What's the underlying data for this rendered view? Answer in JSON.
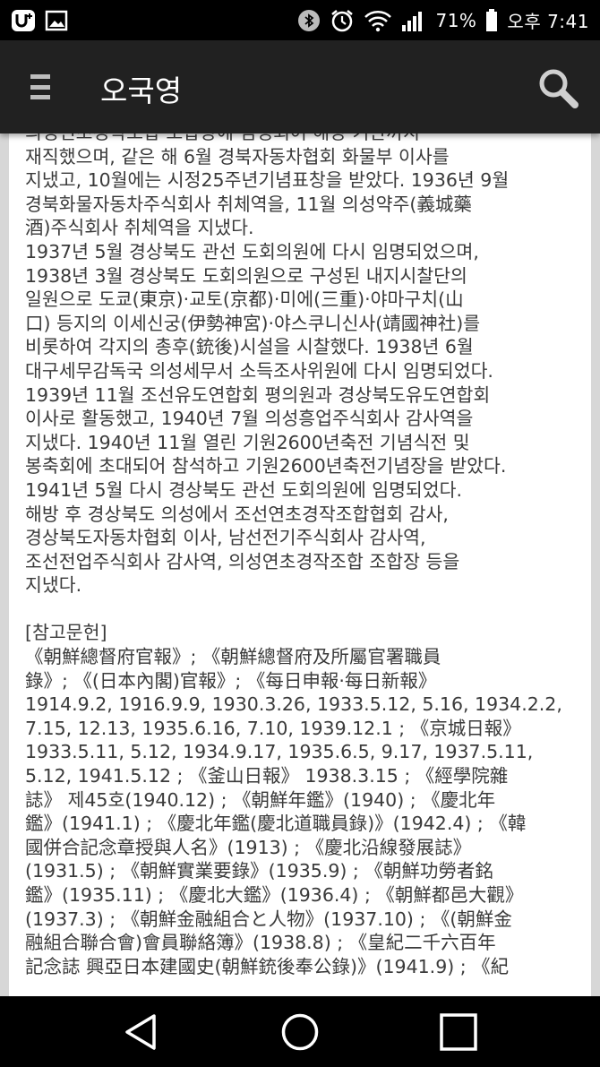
{
  "status_bar": {
    "battery_percent": "71%",
    "time": "오후 7:41",
    "icons": [
      "u-plus-icon",
      "image-icon",
      "bluetooth-icon",
      "alarm-icon",
      "wifi-icon",
      "signal-icon",
      "battery-icon"
    ]
  },
  "app_bar": {
    "title": "오국영",
    "menu_icon": "hamburger-menu-icon",
    "search_icon": "search-icon"
  },
  "article": {
    "lines": [
      "의성연초경작조합 조합장에 임명되어 해당 기관까지",
      "재직했으며, 같은 해 6월 경북자동차협회 화물부 이사를",
      "지냈고, 10월에는 시정25주년기념표창을 받았다. 1936년 9월",
      "경북화물자동차주식회사 취체역을, 11월 의성약주(義城藥",
      "酒)주식회사 취체역을 지냈다.",
      "1937년 5월 경상북도 관선 도회의원에 다시 임명되었으며,",
      "1938년 3월 경상북도 도회의원으로 구성된 내지시찰단의",
      "일원으로 도쿄(東京)·교토(京都)·미에(三重)·야마구치(山",
      "口) 등지의 이세신궁(伊勢神宮)·야스쿠니신사(靖國神社)를",
      "비롯하여 각지의 총후(銃後)시설을 시찰했다. 1938년 6월",
      "대구세무감독국 의성세무서 소득조사위원에 다시 임명되었다.",
      "1939년 11월 조선유도연합회 평의원과 경상북도유도연합회",
      "이사로 활동했고, 1940년 7월 의성흥업주식회사 감사역을",
      "지냈다. 1940년 11월 열린 기원2600년축전 기념식전 및",
      "봉축회에 초대되어 참석하고 기원2600년축전기념장을 받았다.",
      "1941년 5월 다시 경상북도 관선 도회의원에 임명되었다.",
      "해방 후 경상북도 의성에서 조선연초경작조합협회 감사,",
      "경상북도자동차협회 이사, 남선전기주식회사 감사역,",
      "조선전업주식회사 감사역, 의성연초경작조합 조합장 등을",
      "지냈다.",
      "",
      "[참고문헌]",
      "《朝鮮總督府官報》; 《朝鮮總督府及所屬官署職員",
      "錄》; 《(日本內閣)官報》; 《每日申報·每日新報》",
      "1914.9.2, 1916.9.9, 1930.3.26, 1933.5.12, 5.16, 1934.2.2,",
      "7.15, 12.13, 1935.6.16, 7.10, 1939.12.1 ; 《京城日報》",
      "1933.5.11, 5.12, 1934.9.17, 1935.6.5, 9.17, 1937.5.11,",
      "5.12, 1941.5.12 ; 《釜山日報》 1938.3.15 ; 《經學院雜",
      "誌》 제45호(1940.12) ; 《朝鮮年鑑》(1940) ; 《慶北年",
      "鑑》(1941.1) ; 《慶北年鑑(慶北道職員錄)》(1942.4) ; 《韓",
      "國併合記念章授與人名》(1913) ; 《慶北沿線發展誌》",
      "(1931.5) ; 《朝鮮實業要錄》(1935.9) ; 《朝鮮功勞者銘",
      "鑑》(1935.11) ; 《慶北大鑑》(1936.4) ; 《朝鮮都邑大觀》",
      "(1937.3) ; 《朝鮮金融組合と人物》(1937.10) ; 《(朝鮮金",
      "融組合聯合會)會員聯絡簿》(1938.8) ; 《皇紀二千六百年",
      "記念誌 興亞日本建國史(朝鮮銃後奉公錄)》(1941.9) ; 《紀"
    ]
  },
  "nav_bar": {
    "buttons": [
      "back-button",
      "home-button",
      "recents-button"
    ]
  }
}
